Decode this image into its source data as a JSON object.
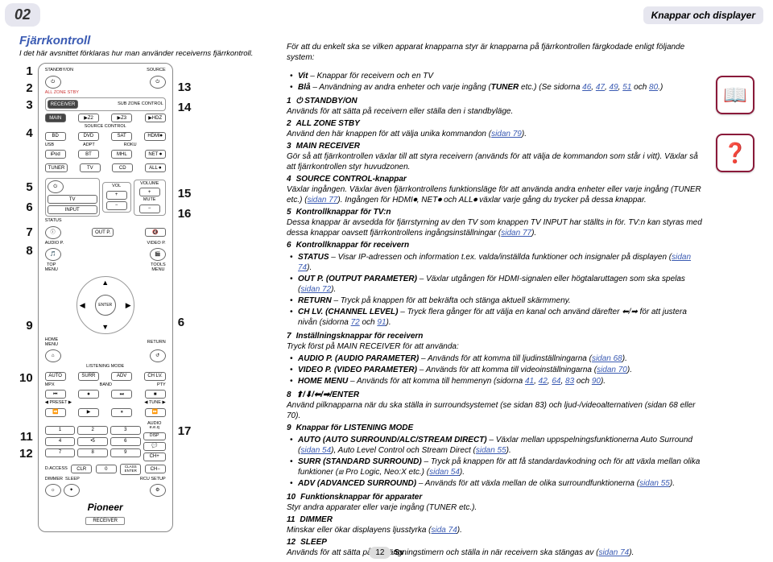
{
  "chapter": {
    "pagenum_bubble": "02",
    "top_right": "Knappar och displayer"
  },
  "left": {
    "title": "Fjärrkontroll",
    "subtitle": "I det här avsnittet förklaras hur man använder receiverns fjärrkontroll.",
    "callouts_left": [
      "1",
      "2",
      "3",
      "4",
      "5",
      "6",
      "7",
      "8",
      "9",
      "10",
      "11",
      "12"
    ],
    "callouts_right_top": [
      "13",
      "14"
    ],
    "callouts_right_mid": [
      "15",
      "16"
    ],
    "callouts_right_lower": [
      "6"
    ],
    "callouts_right_bottom": [
      "17"
    ]
  },
  "remote": {
    "standby": "STANDBY/ON",
    "source": "SOURCE",
    "all_zone_stby": "ALL ZONE STBY",
    "receiver_label": "RECEIVER",
    "sub_zone": "SUB ZONE CONTROL",
    "main": "MAIN",
    "z2": "▶Z2",
    "z3": "▶Z3",
    "hdz": "▶HDZ",
    "src_ctrl": "SOURCE CONTROL",
    "bd": "BD",
    "dvd": "DVD",
    "sat": "SAT",
    "hdmi": "HDMI⏺",
    "usb": "USB",
    "adpt": "ADPT",
    "roku": "ROKU",
    "ipod": "iPod",
    "bt": "BT",
    "mhl": "MHL",
    "net": "NET ⏺",
    "tuner": "TUNER",
    "tv": "TV",
    "cd": "CD",
    "all": "ALL ⏺",
    "tv_btn": "TV",
    "vol": "VOL",
    "mute": "MUTE",
    "volume": "VOLUME",
    "input": "INPUT",
    "plus": "+",
    "minus": "−",
    "status": "STATUS",
    "outp": "OUT P.",
    "mute_btn": "🔇",
    "audiop": "AUDIO P.",
    "videop": "VIDEO P.",
    "top_menu": "TOP\nMENU",
    "tools_menu": "TOOLS\nMENU",
    "enter": "ENTER",
    "home_menu": "HOME\nMENU",
    "return": "RETURN",
    "listening": "LISTENING MODE",
    "auto": "AUTO",
    "surr": "SURR",
    "adv": "ADV",
    "chlv": "CH LV.",
    "mpx": "MPX",
    "band": "BAND",
    "pty": "PTY",
    "preset": "PRESET",
    "tune": "TUNE",
    "prev": "⏮",
    "stop_g": "⏹",
    "next": "⏭",
    "rew": "⏪",
    "play": "▶",
    "pause": "⏸",
    "ff": "⏩",
    "audio_eq": "AUDIO\ne.e.q",
    "disp": "DISP",
    "ch_plus": "CH+",
    "ch_minus": "CH−",
    "daccess": "D.ACCESS",
    "clr": "CLR",
    "zero": "0",
    "class_enter": "CLASS\nENTER",
    "dimmer": "DIMMER",
    "sleep": "SLEEP",
    "rcu": "RCU SETUP",
    "brand": "Pioneer",
    "subbrand": "RECEIVER",
    "nums": [
      "1",
      "2",
      "3",
      "4",
      "•5",
      "6",
      "7",
      "8",
      "9"
    ]
  },
  "intro": {
    "lead": "För att du enkelt ska se vilken apparat knapparna styr är knapparna på fjärrkontrollen färgkodade enligt följande system:",
    "bullets": [
      "Vit – Knappar för receivern och en TV",
      "Blå – Användning av andra enheter och varje ingång (TUNER etc.) (Se sidorna 46, 47, 49, 51 och 80.)"
    ]
  },
  "items": [
    {
      "n": "1",
      "t": "⏻ STANDBY/ON",
      "b": "Används för att sätta på receivern eller ställa den i standbyläge."
    },
    {
      "n": "2",
      "t": "ALL ZONE STBY",
      "b": "Använd den här knappen för att välja unika kommandon (sidan 79)."
    },
    {
      "n": "3",
      "t": "MAIN RECEIVER",
      "b": "Gör så att fjärrkontrollen växlar till att styra receivern (används för att välja de kommandon som står i vitt). Växlar så att fjärrkontrollen styr huvudzonen."
    },
    {
      "n": "4",
      "t": "SOURCE CONTROL-knappar",
      "b": "Växlar ingången. Växlar även fjärrkontrollens funktionsläge för att använda andra enheter eller varje ingång (TUNER etc.) (sidan 77). Ingången för HDMI⏺, NET⏺ och ALL⏺ växlar varje gång du trycker på dessa knappar."
    },
    {
      "n": "5",
      "t": "Kontrollknappar för TV:n",
      "b": "Dessa knappar är avsedda för fjärrstyrning av den TV som knappen TV INPUT har ställts in för. TV:n kan styras med dessa knappar oavsett fjärrkontrollens ingångsinställningar (sidan 77)."
    },
    {
      "n": "6",
      "t": "Kontrollknappar för receivern",
      "b": "",
      "sub": [
        "STATUS – Visar IP-adressen och information t.ex. valda/inställda funktioner och insignaler på displayen (sidan 74).",
        "OUT P. (OUTPUT PARAMETER) – Växlar utgången för HDMI-signalen eller högtalaruttagen som ska spelas (sidan 72).",
        "RETURN – Tryck på knappen för att bekräfta och stänga aktuell skärmmeny.",
        "CH LV. (CHANNEL LEVEL) – Tryck flera gånger för att välja en kanal och använd därefter ⬅/➡ för att justera nivån (sidorna 72 och 91)."
      ]
    },
    {
      "n": "7",
      "t": "Inställningsknappar för receivern",
      "b": "Tryck först på MAIN RECEIVER för att använda:",
      "sub": [
        "AUDIO P. (AUDIO PARAMETER) – Används för att komma till ljudinställningarna (sidan 68).",
        "VIDEO P. (VIDEO PARAMETER) – Används för att komma till videoinställningarna (sidan 70).",
        "HOME MENU – Används för att komma till hemmenyn (sidorna 41, 42, 64, 83 och 90)."
      ]
    },
    {
      "n": "8",
      "t": "⬆/⬇/⬅/➡/ENTER",
      "b": "Använd pilknapparna när du ska ställa in surroundsystemet (se sidan 83) och ljud-/videoalternativen (sidan 68 eller 70)."
    },
    {
      "n": "9",
      "t": "Knappar för LISTENING MODE",
      "b": "",
      "sub": [
        "AUTO (AUTO SURROUND/ALC/STREAM DIRECT) – Växlar mellan uppspelningsfunktionerna Auto Surround (sidan 54), Auto Level Control och Stream Direct (sidan 55).",
        "SURR (STANDARD SURROUND) – Tryck på knappen för att få standardavkodning och för att växla mellan olika funktioner (⧈ Pro Logic, Neo:X etc.) (sidan 54).",
        "ADV (ADVANCED SURROUND) – Används för att växla mellan de olika surroundfunktionerna (sidan 55)."
      ]
    },
    {
      "n": "10",
      "t": "Funktionsknappar för apparater",
      "b": "Styr andra apparater eller varje ingång (TUNER etc.)."
    },
    {
      "n": "11",
      "t": "DIMMER",
      "b": "Minskar eller ökar displayens ljusstyrka (sida 74)."
    },
    {
      "n": "12",
      "t": "SLEEP",
      "b": "Används för att sätta på avstängningstimern och ställa in när receivern ska stängas av (sidan 74)."
    }
  ],
  "footer": {
    "page": "12",
    "lang": "Sv"
  }
}
